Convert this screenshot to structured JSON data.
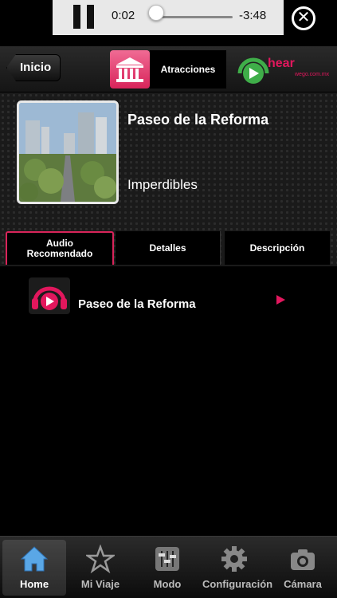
{
  "player": {
    "elapsed": "0:02",
    "remaining": "-3:48",
    "progress": 0.009,
    "close_glyph": "✕"
  },
  "navbar": {
    "back_label": "Inicio",
    "category_label": "Atracciones",
    "category_icon": "museum-icon",
    "logo": {
      "text": "hear",
      "sub": "wego.com.mx",
      "color": "#e2175d"
    }
  },
  "place": {
    "title": "Paseo de la Reforma",
    "category": "Imperdibles"
  },
  "tabs": [
    {
      "label": "Audio Recomendado",
      "active": true
    },
    {
      "label": "Detalles",
      "active": false
    },
    {
      "label": "Descripción",
      "active": false
    }
  ],
  "audio_list": [
    {
      "label": "Paseo de la Reforma",
      "icon": "headphones-play-icon"
    }
  ],
  "tabbar": [
    {
      "label": "Home",
      "icon": "home-icon",
      "selected": true
    },
    {
      "label": "Mi Viaje",
      "icon": "star-icon",
      "selected": false
    },
    {
      "label": "Modo",
      "icon": "sliders-icon",
      "selected": false
    },
    {
      "label": "Configuración",
      "icon": "gear-icon",
      "selected": false
    },
    {
      "label": "Cámara",
      "icon": "camera-icon",
      "selected": false
    }
  ],
  "colors": {
    "accent": "#e2175d",
    "category_bg": "#d8245a",
    "active_tab_border": "#d8245a",
    "background": "#000000"
  }
}
